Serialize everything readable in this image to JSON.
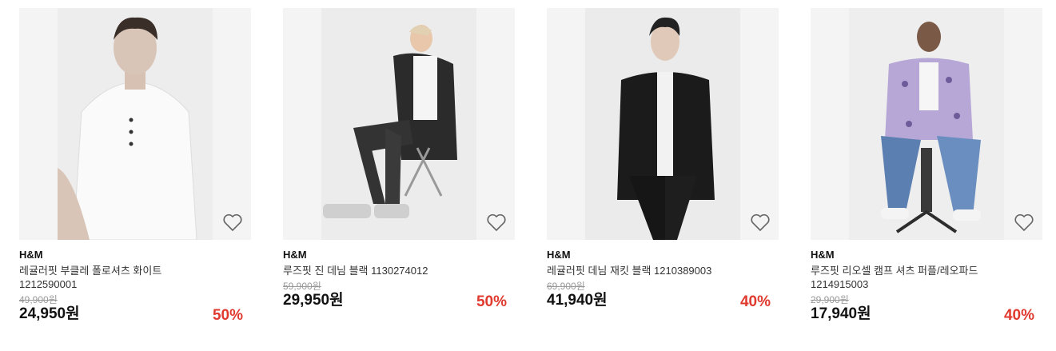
{
  "products": [
    {
      "brand": "H&M",
      "title": "레귤러핏 부클레 폴로셔츠 화이트 1212590001",
      "original_price": "49,900원",
      "price": "24,950원",
      "discount": "50%"
    },
    {
      "brand": "H&M",
      "title": "루즈핏 진 데님 블랙 1130274012",
      "original_price": "59,900원",
      "price": "29,950원",
      "discount": "50%"
    },
    {
      "brand": "H&M",
      "title": "레귤러핏 데님 재킷 블랙 1210389003",
      "original_price": "69,900원",
      "price": "41,940원",
      "discount": "40%"
    },
    {
      "brand": "H&M",
      "title": "루즈핏 리오셀 캠프 셔츠 퍼플/레오파드 1214915003",
      "original_price": "29,900원",
      "price": "17,940원",
      "discount": "40%"
    }
  ],
  "icons": {
    "wishlist": "heart-outline-icon"
  },
  "colors": {
    "discount": "#e03a2f",
    "original_price": "#9a9a9a"
  }
}
